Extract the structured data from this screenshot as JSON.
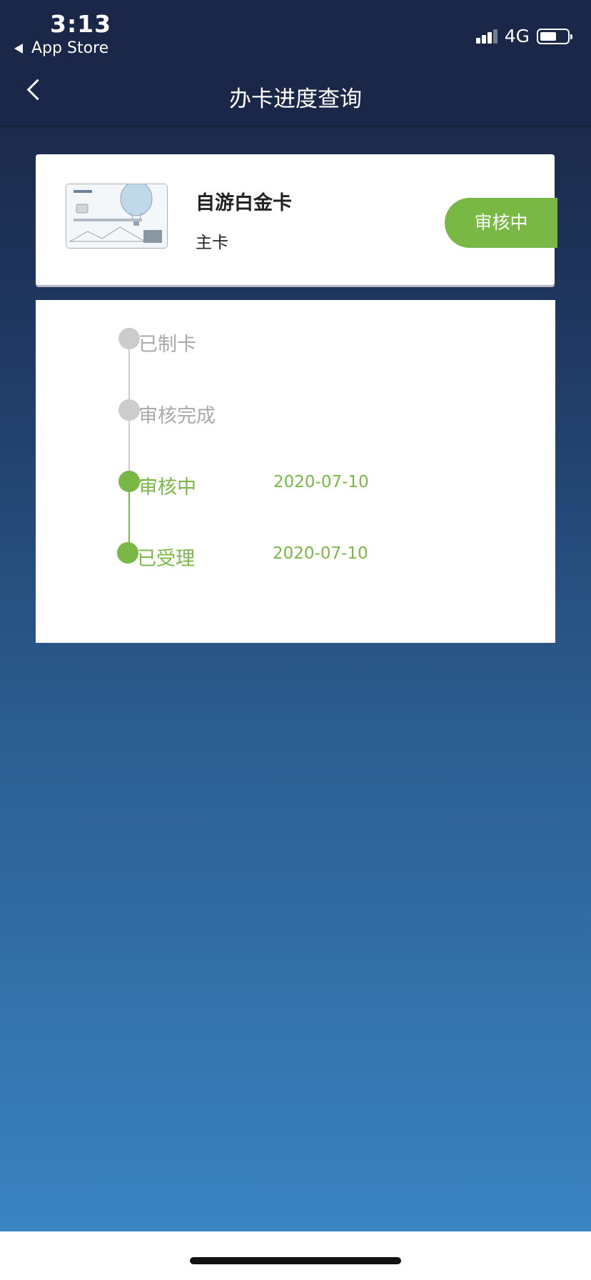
{
  "status_bar": {
    "time": "3:13",
    "back_app": "App Store",
    "network": "4G",
    "battery_level": 0.6
  },
  "nav": {
    "title": "办卡进度查询",
    "back_icon": "chevron-left-icon"
  },
  "card": {
    "name": "自游白金卡",
    "type": "主卡",
    "status": "审核中",
    "status_color": "#7ab846",
    "image_icon": "credit-card-image"
  },
  "timeline": {
    "steps": [
      {
        "label": "已制卡",
        "date": "",
        "state": "pending"
      },
      {
        "label": "审核完成",
        "date": "",
        "state": "pending"
      },
      {
        "label": "审核中",
        "date": "2020-07-10",
        "state": "done"
      },
      {
        "label": "已受理",
        "date": "2020-07-10",
        "state": "done"
      }
    ],
    "done_color": "#7ab846",
    "pending_color": "#cccccc"
  }
}
